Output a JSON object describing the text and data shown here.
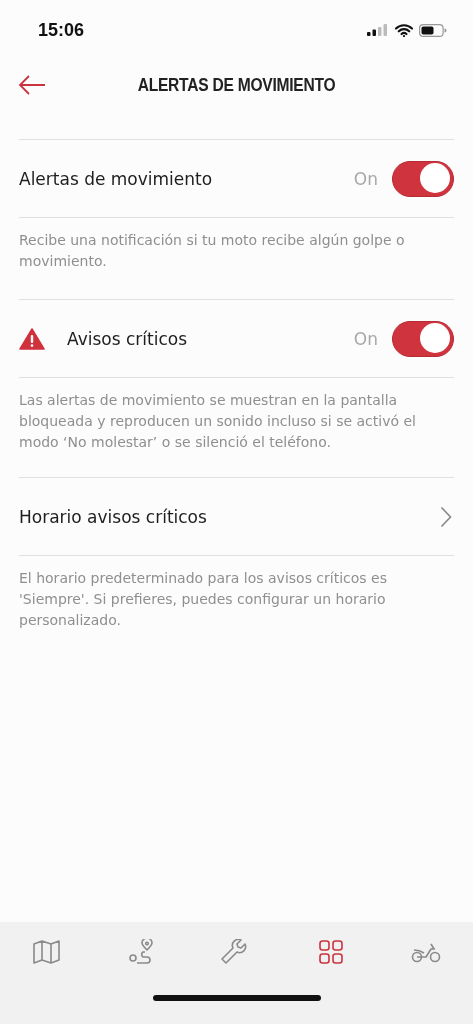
{
  "status_bar": {
    "time": "15:06"
  },
  "header": {
    "title": "ALERTAS DE MOVIMIENTO"
  },
  "sections": [
    {
      "kind": "toggle",
      "alert": false,
      "label": "Alertas de movimiento",
      "state_text": "On",
      "on": true,
      "description": "Recibe una notificación si tu moto recibe algún golpe o movimiento."
    },
    {
      "kind": "toggle",
      "alert": true,
      "label": "Avisos críticos",
      "state_text": "On",
      "on": true,
      "description": "Las alertas de movimiento se muestran en la pantalla bloqueada y reproducen un sonido incluso si se activó el modo ‘No molestar’ o se silenció el teléfono."
    },
    {
      "kind": "link",
      "alert": false,
      "label": "Horario avisos críticos",
      "description": "El horario predeterminado para los avisos críticos es 'Siempre'. Si prefieres, puedes configurar un horario personalizado."
    }
  ],
  "tab_bar": [
    {
      "kind": "map",
      "selected": false
    },
    {
      "kind": "route",
      "selected": false
    },
    {
      "kind": "wrench",
      "selected": false
    },
    {
      "kind": "grid",
      "selected": true
    },
    {
      "kind": "motorcycle",
      "selected": false
    }
  ]
}
